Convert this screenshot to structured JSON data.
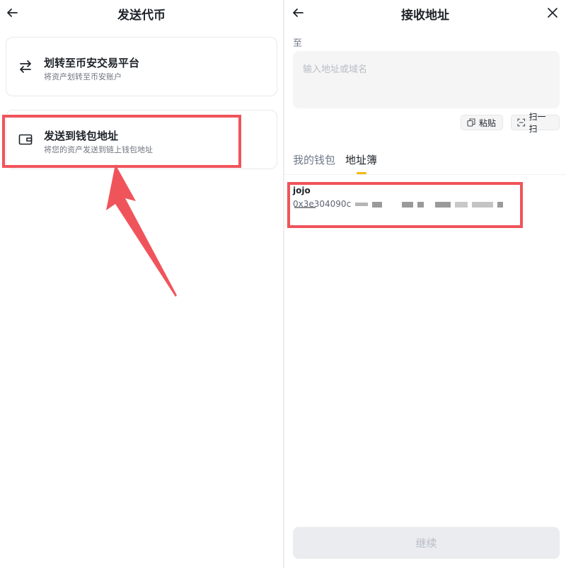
{
  "left": {
    "title": "发送代币",
    "options": [
      {
        "title": "划转至币安交易平台",
        "desc": "将资产划转至币安账户",
        "icon": "transfer-arrows-icon"
      },
      {
        "title": "发送到钱包地址",
        "desc": "将您的资产发送到链上钱包地址",
        "icon": "wallet-icon"
      }
    ]
  },
  "right": {
    "title": "接收地址",
    "to_label": "至",
    "address_placeholder": "输入地址或域名",
    "paste_label": "粘贴",
    "scan_label": "扫一扫",
    "tabs": [
      {
        "label": "我的钱包",
        "active": false
      },
      {
        "label": "地址簿",
        "active": true
      }
    ],
    "address_book": [
      {
        "name": "jojo",
        "address_prefix": "0x3e304090c"
      }
    ],
    "continue_label": "继续"
  },
  "colors": {
    "highlight": "#f0545b",
    "accent": "#f0b90b"
  }
}
